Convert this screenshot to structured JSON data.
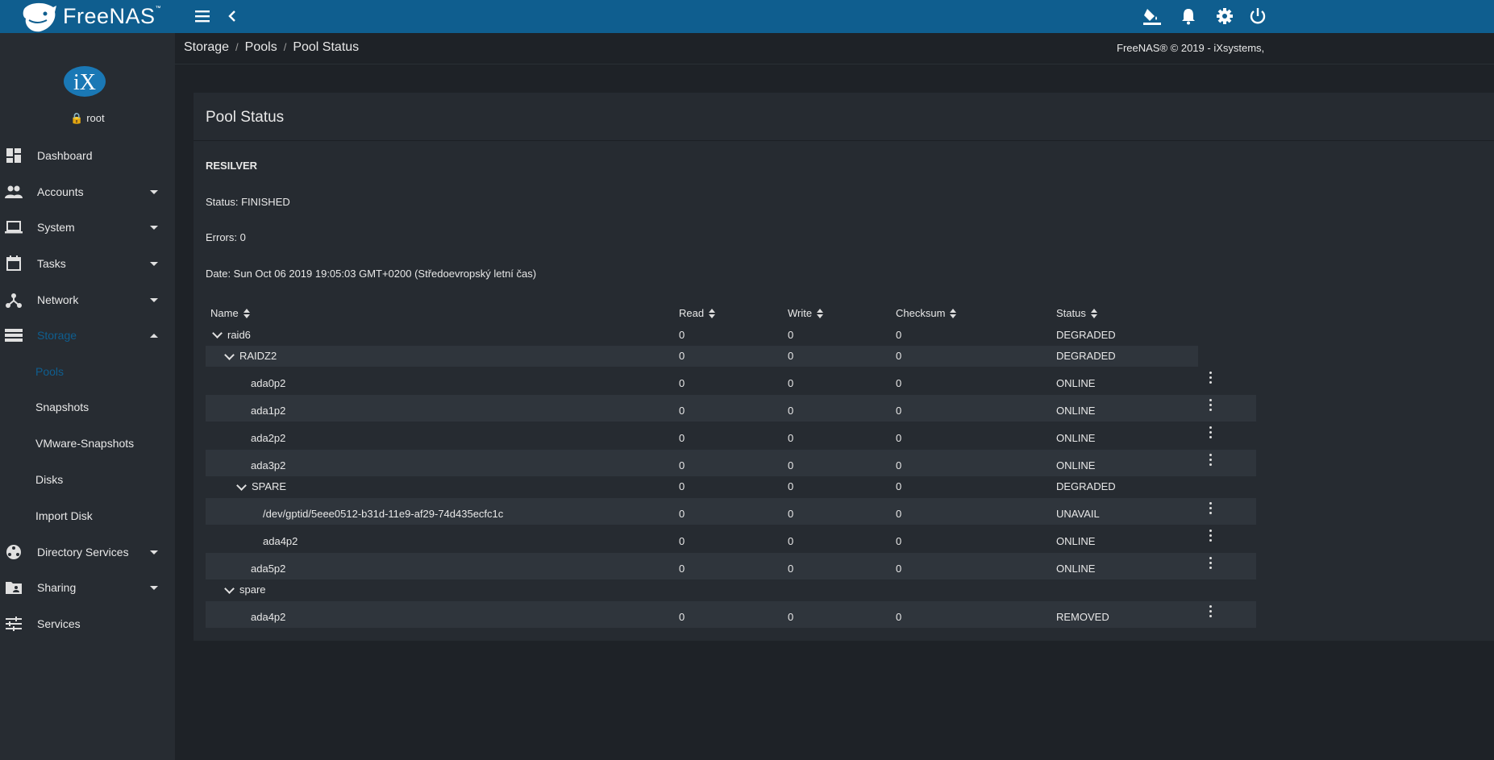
{
  "app": {
    "logo_text": "FreeNAS",
    "logo_tm": "™",
    "brand_color": "#0f5e8f"
  },
  "topbar": {
    "icons": [
      "menu-icon",
      "back-chevron-icon",
      "paint-bucket-icon",
      "bell-icon",
      "gear-icon",
      "power-icon"
    ]
  },
  "user": {
    "name": "root"
  },
  "sidebar": {
    "items": [
      {
        "label": "Dashboard",
        "icon": "dashboard-icon"
      },
      {
        "label": "Accounts",
        "icon": "people-icon"
      },
      {
        "label": "System",
        "icon": "laptop-icon"
      },
      {
        "label": "Tasks",
        "icon": "calendar-icon"
      },
      {
        "label": "Network",
        "icon": "network-icon"
      },
      {
        "label": "Storage",
        "icon": "storage-icon"
      },
      {
        "label": "Directory Services",
        "icon": "directory-icon"
      },
      {
        "label": "Sharing",
        "icon": "folder-share-icon"
      },
      {
        "label": "Services",
        "icon": "sliders-icon"
      }
    ],
    "storage_sub": [
      "Pools",
      "Snapshots",
      "VMware-Snapshots",
      "Disks",
      "Import Disk"
    ]
  },
  "breadcrumb": [
    "Storage",
    "Pools",
    "Pool Status"
  ],
  "copyright": "FreeNAS® © 2019 - iXsystems,",
  "card": {
    "title": "Pool Status",
    "section": "RESILVER",
    "status": "Status: FINISHED",
    "errors": "Errors: 0",
    "date": "Date: Sun Oct 06 2019 19:05:03 GMT+0200 (Středoevropský letní čas)"
  },
  "table": {
    "headers": [
      "Name",
      "Read",
      "Write",
      "Checksum",
      "Status"
    ],
    "rows": [
      {
        "name": "raid6",
        "read": "0",
        "write": "0",
        "checksum": "0",
        "status": "DEGRADED"
      },
      {
        "name": "RAIDZ2",
        "read": "0",
        "write": "0",
        "checksum": "0",
        "status": "DEGRADED"
      },
      {
        "name": "ada0p2",
        "read": "0",
        "write": "0",
        "checksum": "0",
        "status": "ONLINE"
      },
      {
        "name": "ada1p2",
        "read": "0",
        "write": "0",
        "checksum": "0",
        "status": "ONLINE"
      },
      {
        "name": "ada2p2",
        "read": "0",
        "write": "0",
        "checksum": "0",
        "status": "ONLINE"
      },
      {
        "name": "ada3p2",
        "read": "0",
        "write": "0",
        "checksum": "0",
        "status": "ONLINE"
      },
      {
        "name": "SPARE",
        "read": "0",
        "write": "0",
        "checksum": "0",
        "status": "DEGRADED"
      },
      {
        "name": "/dev/gptid/5eee0512-b31d-11e9-af29-74d435ecfc1c",
        "read": "0",
        "write": "0",
        "checksum": "0",
        "status": "UNAVAIL"
      },
      {
        "name": "ada4p2",
        "read": "0",
        "write": "0",
        "checksum": "0",
        "status": "ONLINE"
      },
      {
        "name": "ada5p2",
        "read": "0",
        "write": "0",
        "checksum": "0",
        "status": "ONLINE"
      },
      {
        "name": "spare",
        "read": "",
        "write": "",
        "checksum": "",
        "status": ""
      },
      {
        "name": "ada4p2",
        "read": "0",
        "write": "0",
        "checksum": "0",
        "status": "REMOVED"
      }
    ]
  }
}
